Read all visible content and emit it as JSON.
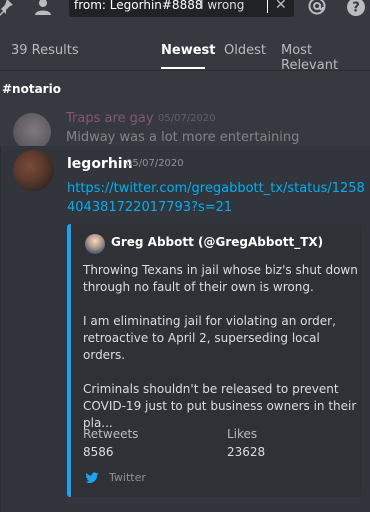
{
  "topbar": {
    "search_from_label": "from:",
    "search_from_value": "Legorhin#8888",
    "search_text": "I wrong"
  },
  "results": {
    "count_label": "39 Results",
    "tabs": [
      {
        "label": "Newest",
        "active": true
      },
      {
        "label": "Oldest",
        "active": false
      },
      {
        "label": "Most Relevant",
        "active": false
      }
    ]
  },
  "channel": "#notario",
  "context_message": {
    "author": "Traps are gay",
    "timestamp": "05/07/2020",
    "text": "Midway was a lot more entertaining"
  },
  "message": {
    "author": "legorhin",
    "timestamp": "05/07/2020",
    "link": "https://twitter.com/gregabbott_tx/status/1258404381722017793?s=21",
    "embed": {
      "author": "Greg Abbott (@GregAbbott_TX)",
      "paragraphs": [
        "Throwing Texans in jail whose biz's shut down through no fault of their own is wrong.",
        "I am eliminating jail for violating an order, retroactive to April 2, superseding local orders.",
        "Criminals shouldn't be released to prevent COVID-19 just to put business owners in their pla..."
      ],
      "fields": [
        {
          "name": "Retweets",
          "value": "8586"
        },
        {
          "name": "Likes",
          "value": "23628"
        }
      ],
      "footer": "Twitter",
      "accent_color": "#1da1f2"
    }
  },
  "colors": {
    "background": "#36393f",
    "link": "#00b0f4",
    "context_author": "#e878b8"
  }
}
